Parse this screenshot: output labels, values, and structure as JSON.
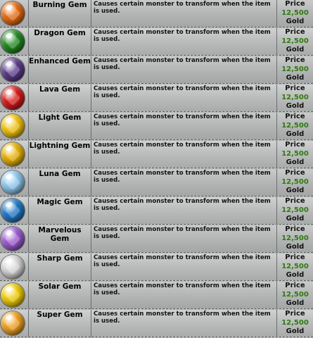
{
  "shop": {
    "items": [
      {
        "name": "Burning Gem",
        "description": "Causes certain monster to transform when the item is used.",
        "price_label": "Price",
        "price": "12,500",
        "currency": "Gold",
        "icon": "burning-gem-icon",
        "color": "#e56a10"
      },
      {
        "name": "Dragon Gem",
        "description": "Causes certain monster to transform when the item is used.",
        "price_label": "Price",
        "price": "12,500",
        "currency": "Gold",
        "icon": "dragon-gem-icon",
        "color": "#1f8a1f"
      },
      {
        "name": "Enhanced Gem",
        "description": "Causes certain monster to transform when the item is used.",
        "price_label": "Price",
        "price": "12,500",
        "currency": "Gold",
        "icon": "enhanced-gem-icon",
        "color": "#5a3a8a"
      },
      {
        "name": "Lava Gem",
        "description": "Causes certain monster to transform when the item is used.",
        "price_label": "Price",
        "price": "12,500",
        "currency": "Gold",
        "icon": "lava-gem-icon",
        "color": "#d81818"
      },
      {
        "name": "Light Gem",
        "description": "Causes certain monster to transform when the item is used.",
        "price_label": "Price",
        "price": "12,500",
        "currency": "Gold",
        "icon": "light-gem-icon",
        "color": "#f2c20a"
      },
      {
        "name": "Lightning Gem",
        "description": "Causes certain monster to transform when the item is used.",
        "price_label": "Price",
        "price": "12,500",
        "currency": "Gold",
        "icon": "lightning-gem-icon",
        "color": "#e8b000"
      },
      {
        "name": "Luna Gem",
        "description": "Causes certain monster to transform when the item is used.",
        "price_label": "Price",
        "price": "12,500",
        "currency": "Gold",
        "icon": "luna-gem-icon",
        "color": "#8cc8ee"
      },
      {
        "name": "Magic Gem",
        "description": "Causes certain monster to transform when the item is used.",
        "price_label": "Price",
        "price": "12,500",
        "currency": "Gold",
        "icon": "magic-gem-icon",
        "color": "#1e78c8"
      },
      {
        "name": "Marvelous Gem",
        "description": "Causes certain monster to transform when the item is used.",
        "price_label": "Price",
        "price": "12,500",
        "currency": "Gold",
        "icon": "marvelous-gem-icon",
        "color": "#9c5ad0"
      },
      {
        "name": "Sharp Gem",
        "description": "Causes certain monster to transform when the item is used.",
        "price_label": "Price",
        "price": "12,500",
        "currency": "Gold",
        "icon": "sharp-gem-icon",
        "color": "#d8d8d8"
      },
      {
        "name": "Solar Gem",
        "description": "Causes certain monster to transform when the item is used.",
        "price_label": "Price",
        "price": "12,500",
        "currency": "Gold",
        "icon": "solar-gem-icon",
        "color": "#f0cc00"
      },
      {
        "name": "Super Gem",
        "description": "Causes certain monster to transform when the item is used.",
        "price_label": "Price",
        "price": "12,500",
        "currency": "Gold",
        "icon": "super-gem-icon",
        "color": "#f0a020"
      }
    ]
  }
}
